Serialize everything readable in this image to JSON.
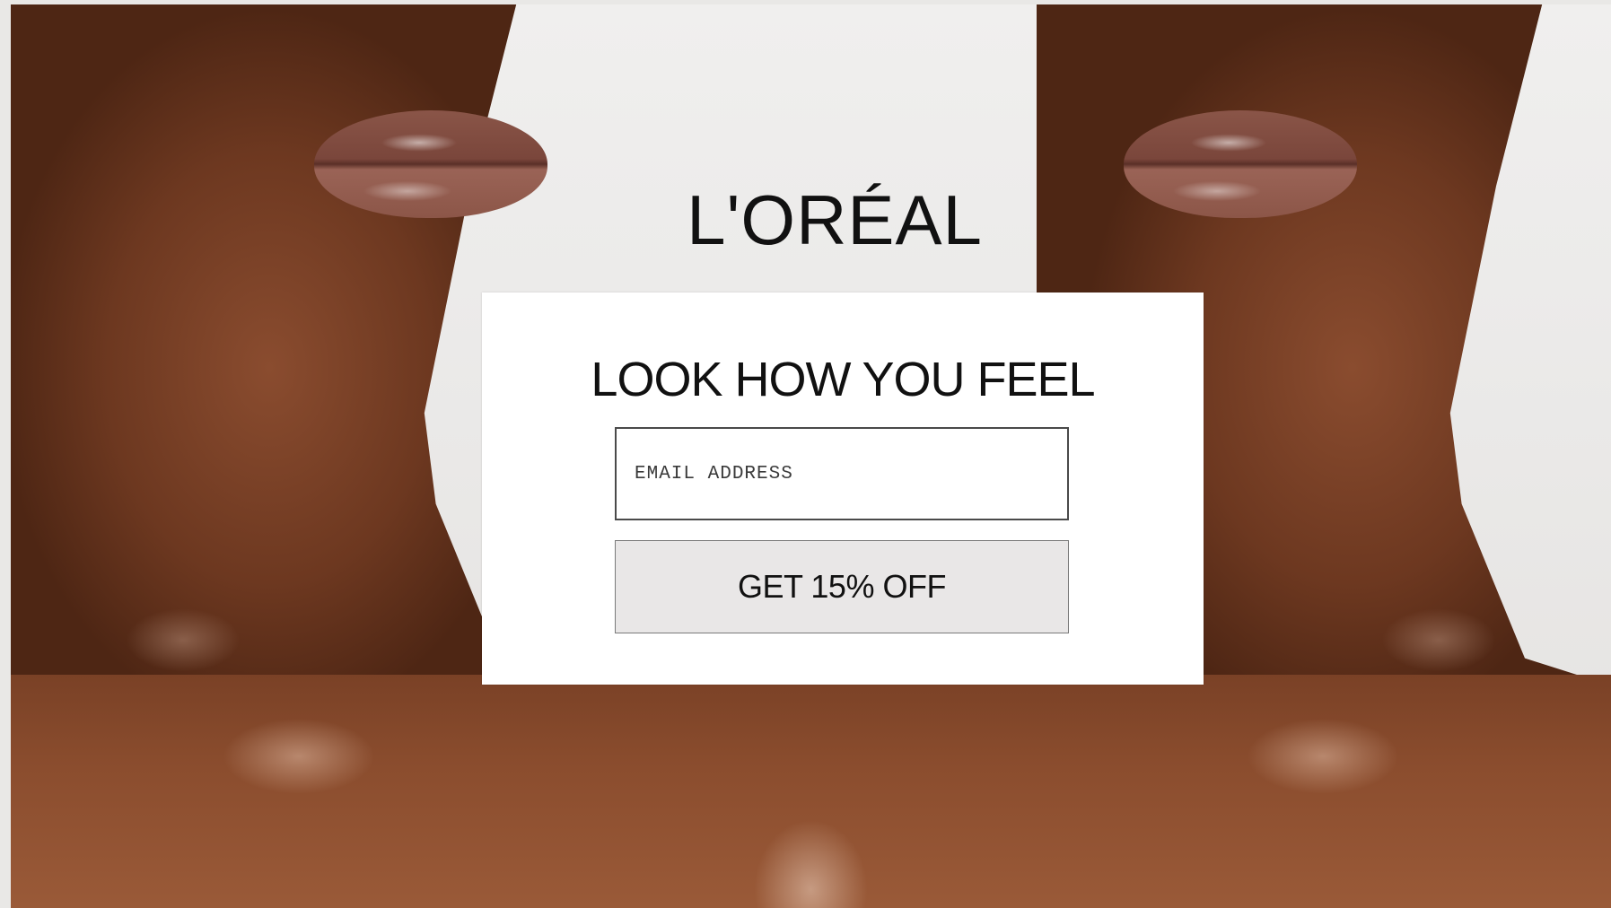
{
  "brand": {
    "logo_text": "L'ORÉAL"
  },
  "popup": {
    "headline": "LOOK HOW YOU FEEL",
    "email_placeholder": "EMAIL ADDRESS",
    "email_value": "",
    "cta_label": "GET 15% OFF"
  },
  "colors": {
    "card_background": "#ffffff",
    "button_background": "#e9e7e7",
    "text": "#111111",
    "skin_tone": "#7a4126"
  }
}
